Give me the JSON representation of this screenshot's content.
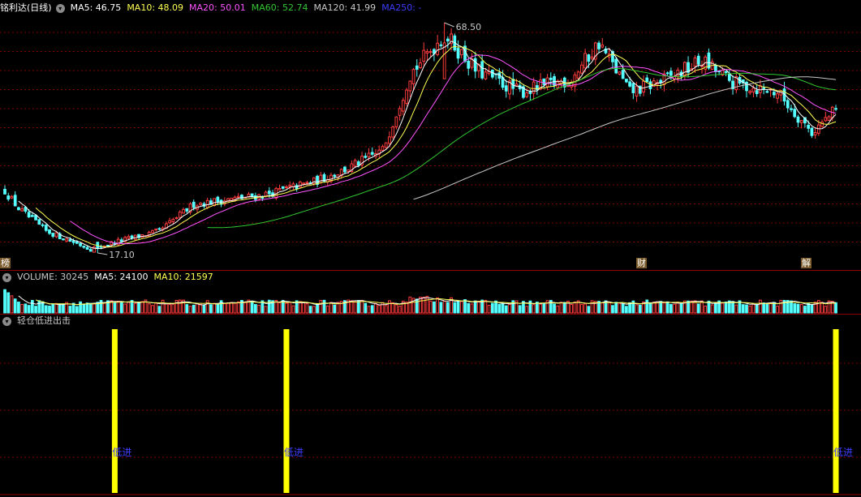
{
  "colors": {
    "up": "#ff3c3c",
    "down": "#54ffff",
    "ma5": "#ffffff",
    "ma10": "#ffff54",
    "ma20": "#ff54ff",
    "ma60": "#31c731",
    "ma120": "#c8c8c8",
    "ma250": "#3c3cff",
    "signal": "#ffff00",
    "signal_text": "#3c3cff",
    "grid": "#800000"
  },
  "main": {
    "title": "铭利达(日线)",
    "indicators": [
      {
        "label": "MA5: 46.75",
        "color": "#ffffff"
      },
      {
        "label": "MA10: 48.09",
        "color": "#ffff54"
      },
      {
        "label": "MA20: 50.01",
        "color": "#ff54ff"
      },
      {
        "label": "MA60: 52.74",
        "color": "#31c731"
      },
      {
        "label": "MA120: 41.99",
        "color": "#c8c8c8"
      },
      {
        "label": "MA250: -",
        "color": "#3c3cff"
      }
    ],
    "high_label": "68.50",
    "low_label": "17.10",
    "flags": [
      "榜",
      "财",
      "解"
    ]
  },
  "volume": {
    "indicators": [
      {
        "label": "VOLUME: 30245",
        "color": "#c8c8c8"
      },
      {
        "label": "MA5: 24100",
        "color": "#ffffff"
      },
      {
        "label": "MA10: 21597",
        "color": "#ffff54"
      }
    ]
  },
  "signal_panel": {
    "title": "轻仓低进出击",
    "marker_text": "低进",
    "marker_text_left_clipped": "进",
    "signal_days": [
      32,
      82,
      242
    ]
  },
  "chart_data": {
    "type": "candlestick",
    "title": "铭利达(日线)",
    "ylim": [
      17.1,
      68.5
    ],
    "days": 243,
    "high": 68.5,
    "low": 17.1,
    "close_path": [
      {
        "day": 0,
        "price": 31
      },
      {
        "day": 4,
        "price": 27
      },
      {
        "day": 12,
        "price": 22
      },
      {
        "day": 25,
        "price": 18
      },
      {
        "day": 32,
        "price": 19.5
      },
      {
        "day": 45,
        "price": 22
      },
      {
        "day": 55,
        "price": 28
      },
      {
        "day": 75,
        "price": 30
      },
      {
        "day": 90,
        "price": 33
      },
      {
        "day": 100,
        "price": 36
      },
      {
        "day": 110,
        "price": 40
      },
      {
        "day": 118,
        "price": 57
      },
      {
        "day": 128,
        "price": 66
      },
      {
        "day": 137,
        "price": 58
      },
      {
        "day": 150,
        "price": 53
      },
      {
        "day": 165,
        "price": 56
      },
      {
        "day": 173,
        "price": 64
      },
      {
        "day": 182,
        "price": 53
      },
      {
        "day": 193,
        "price": 56
      },
      {
        "day": 203,
        "price": 60
      },
      {
        "day": 212,
        "price": 55
      },
      {
        "day": 225,
        "price": 53
      },
      {
        "day": 235,
        "price": 44
      },
      {
        "day": 242,
        "price": 49
      }
    ]
  }
}
